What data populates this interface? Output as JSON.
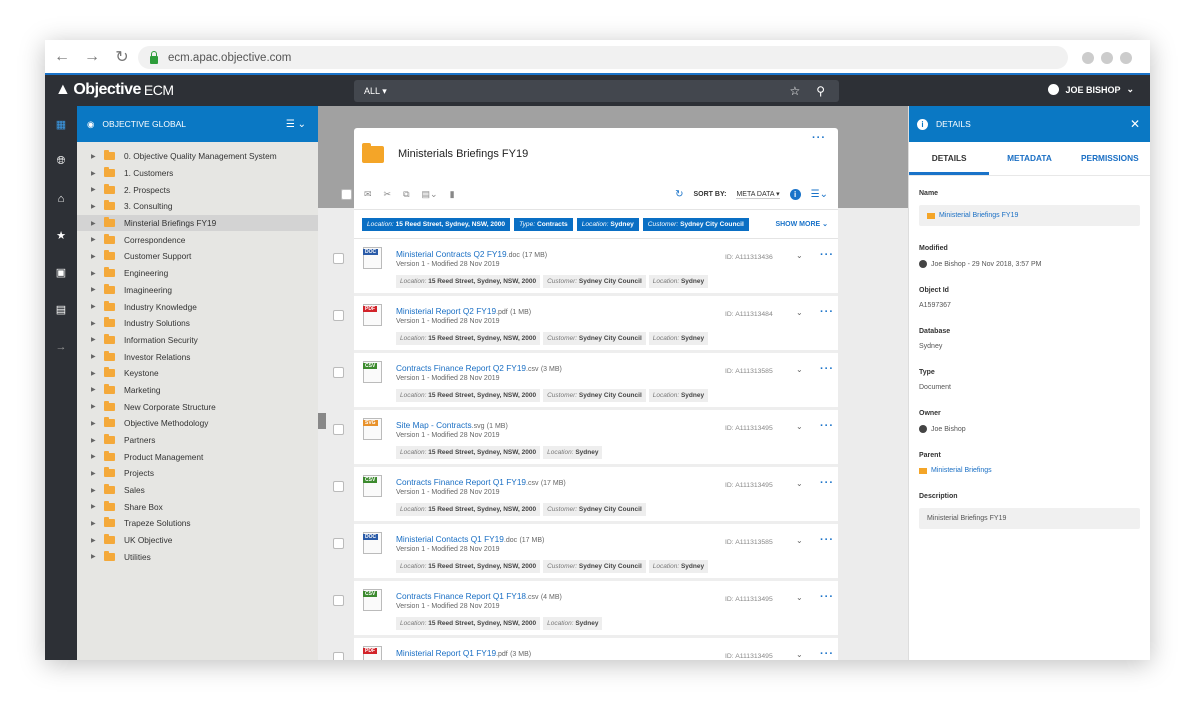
{
  "browser": {
    "url": "ecm.apac.objective.com",
    "back_icon": "arrow-left",
    "forward_icon": "arrow-right",
    "reload_icon": "reload"
  },
  "header": {
    "logo_bold": "Objective",
    "logo_light": "ECM",
    "search_scope": "ALL",
    "user": "JOE BISHOP"
  },
  "rail": {
    "icons": [
      "dashboard",
      "globe",
      "home",
      "star",
      "inbox",
      "search-doc",
      "arrow-right"
    ]
  },
  "tree": {
    "title": "OBJECTIVE GLOBAL",
    "items": [
      "0. Objective Quality Management System",
      "1. Customers",
      "2. Prospects",
      "3. Consulting",
      "Minsterial Briefings FY19",
      "Correspondence",
      "Customer Support",
      "Engineering",
      "Imagineering",
      "Industry Knowledge",
      "Industry Solutions",
      "Information Security",
      "Investor Relations",
      "Keystone",
      "Marketing",
      "New Corporate Structure",
      "Objective Methodology",
      "Partners",
      "Product Management",
      "Projects",
      "Sales",
      "Share Box",
      "Trapeze Solutions",
      "UK Objective",
      "Utilities"
    ],
    "selected_index": 4
  },
  "folder": {
    "title": "Ministerials Briefings FY19",
    "sort_label": "SORT BY:",
    "sort_value": "META DATA",
    "show_more": "SHOW MORE",
    "filters": [
      {
        "k": "Location:",
        "v": "15 Reed Street, Sydney, NSW, 2000"
      },
      {
        "k": "Type:",
        "v": "Contracts"
      },
      {
        "k": "Location:",
        "v": "Sydney"
      },
      {
        "k": "Customer:",
        "v": "Sydney City Council"
      }
    ]
  },
  "files": [
    {
      "type": "DOC",
      "color": "#2a5ba8",
      "name": "Ministerial Contracts Q2 FY19",
      "ext": ".doc",
      "size": "(17 MB)",
      "version": "Version 1 - Modified 28 Nov 2019",
      "id": "ID: A111313436",
      "meta": [
        [
          "Location:",
          "15 Reed Street, Sydney, NSW, 2000"
        ],
        [
          "Customer:",
          "Sydney City Council"
        ],
        [
          "Location:",
          "Sydney"
        ]
      ]
    },
    {
      "type": "PDF",
      "color": "#d2232a",
      "name": "Ministerial Report Q2 FY19",
      "ext": ".pdf",
      "size": "(1 MB)",
      "version": "Version 1 - Modified 28 Nov 2019",
      "id": "ID: A111313484",
      "meta": [
        [
          "Location:",
          "15 Reed Street, Sydney, NSW, 2000"
        ],
        [
          "Customer:",
          "Sydney City Council"
        ],
        [
          "Location:",
          "Sydney"
        ]
      ]
    },
    {
      "type": "CSV",
      "color": "#3c8a2e",
      "name": "Contracts Finance Report Q2 FY19",
      "ext": ".csv",
      "size": "(3 MB)",
      "version": "Version 1 - Modified 28 Nov 2019",
      "id": "ID: A111313585",
      "meta": [
        [
          "Location:",
          "15 Reed Street, Sydney, NSW, 2000"
        ],
        [
          "Customer:",
          "Sydney City Council"
        ],
        [
          "Location:",
          "Sydney"
        ]
      ]
    },
    {
      "type": "SVG",
      "color": "#e8912a",
      "name": "Site Map - Contracts",
      "ext": ".svg",
      "size": "(1 MB)",
      "version": "Version 1 - Modified 28 Nov 2019",
      "id": "ID: A111313495",
      "meta": [
        [
          "Location:",
          "15 Reed Street, Sydney, NSW, 2000"
        ],
        [
          "Location:",
          "Sydney"
        ]
      ]
    },
    {
      "type": "CSV",
      "color": "#3c8a2e",
      "name": "Contracts Finance Report Q1 FY19",
      "ext": ".csv",
      "size": "(17 MB)",
      "version": "Version 1 - Modified 28 Nov 2019",
      "id": "ID: A111313495",
      "meta": [
        [
          "Location:",
          "15 Reed Street, Sydney, NSW, 2000"
        ],
        [
          "Customer:",
          "Sydney City Council"
        ]
      ]
    },
    {
      "type": "DOC",
      "color": "#2a5ba8",
      "name": "Ministerial Contacts Q1 FY19",
      "ext": ".doc",
      "size": "(17 MB)",
      "version": "Version 1 - Modified 28 Nov 2019",
      "id": "ID: A111313585",
      "meta": [
        [
          "Location:",
          "15 Reed Street, Sydney, NSW, 2000"
        ],
        [
          "Customer:",
          "Sydney City Council"
        ],
        [
          "Location:",
          "Sydney"
        ]
      ]
    },
    {
      "type": "CSV",
      "color": "#3c8a2e",
      "name": "Contracts Finance Report Q1 FY18",
      "ext": ".csv",
      "size": "(4 MB)",
      "version": "Version 1 - Modified 28 Nov 2019",
      "id": "ID: A111313495",
      "meta": [
        [
          "Location:",
          "15 Reed Street, Sydney, NSW, 2000"
        ],
        [
          "Location:",
          "Sydney"
        ]
      ]
    },
    {
      "type": "PDF",
      "color": "#d2232a",
      "name": "Ministerial Report Q1 FY19",
      "ext": ".pdf",
      "size": "(3 MB)",
      "version": "Version 1 - Modified 28 Nov 2019",
      "id": "ID: A111313495",
      "meta": []
    }
  ],
  "details": {
    "title": "DETAILS",
    "tabs": [
      "DETAILS",
      "METADATA",
      "PERMISSIONS"
    ],
    "active_tab": 0,
    "fields": [
      {
        "label": "Name",
        "value": "Ministerial Briefings FY19",
        "kind": "box-folder"
      },
      {
        "label": "Modified",
        "value": "Joe Bishop - 29 Nov 2018, 3:57 PM",
        "kind": "user"
      },
      {
        "label": "Object Id",
        "value": "A1597367",
        "kind": "text"
      },
      {
        "label": "Database",
        "value": "Sydney",
        "kind": "text"
      },
      {
        "label": "Type",
        "value": "Document",
        "kind": "text"
      },
      {
        "label": "Owner",
        "value": "Joe Bishop",
        "kind": "user"
      },
      {
        "label": "Parent",
        "value": "Ministerial Briefings",
        "kind": "folder"
      },
      {
        "label": "Description",
        "value": "Ministerial Briefings FY19",
        "kind": "box"
      }
    ]
  }
}
